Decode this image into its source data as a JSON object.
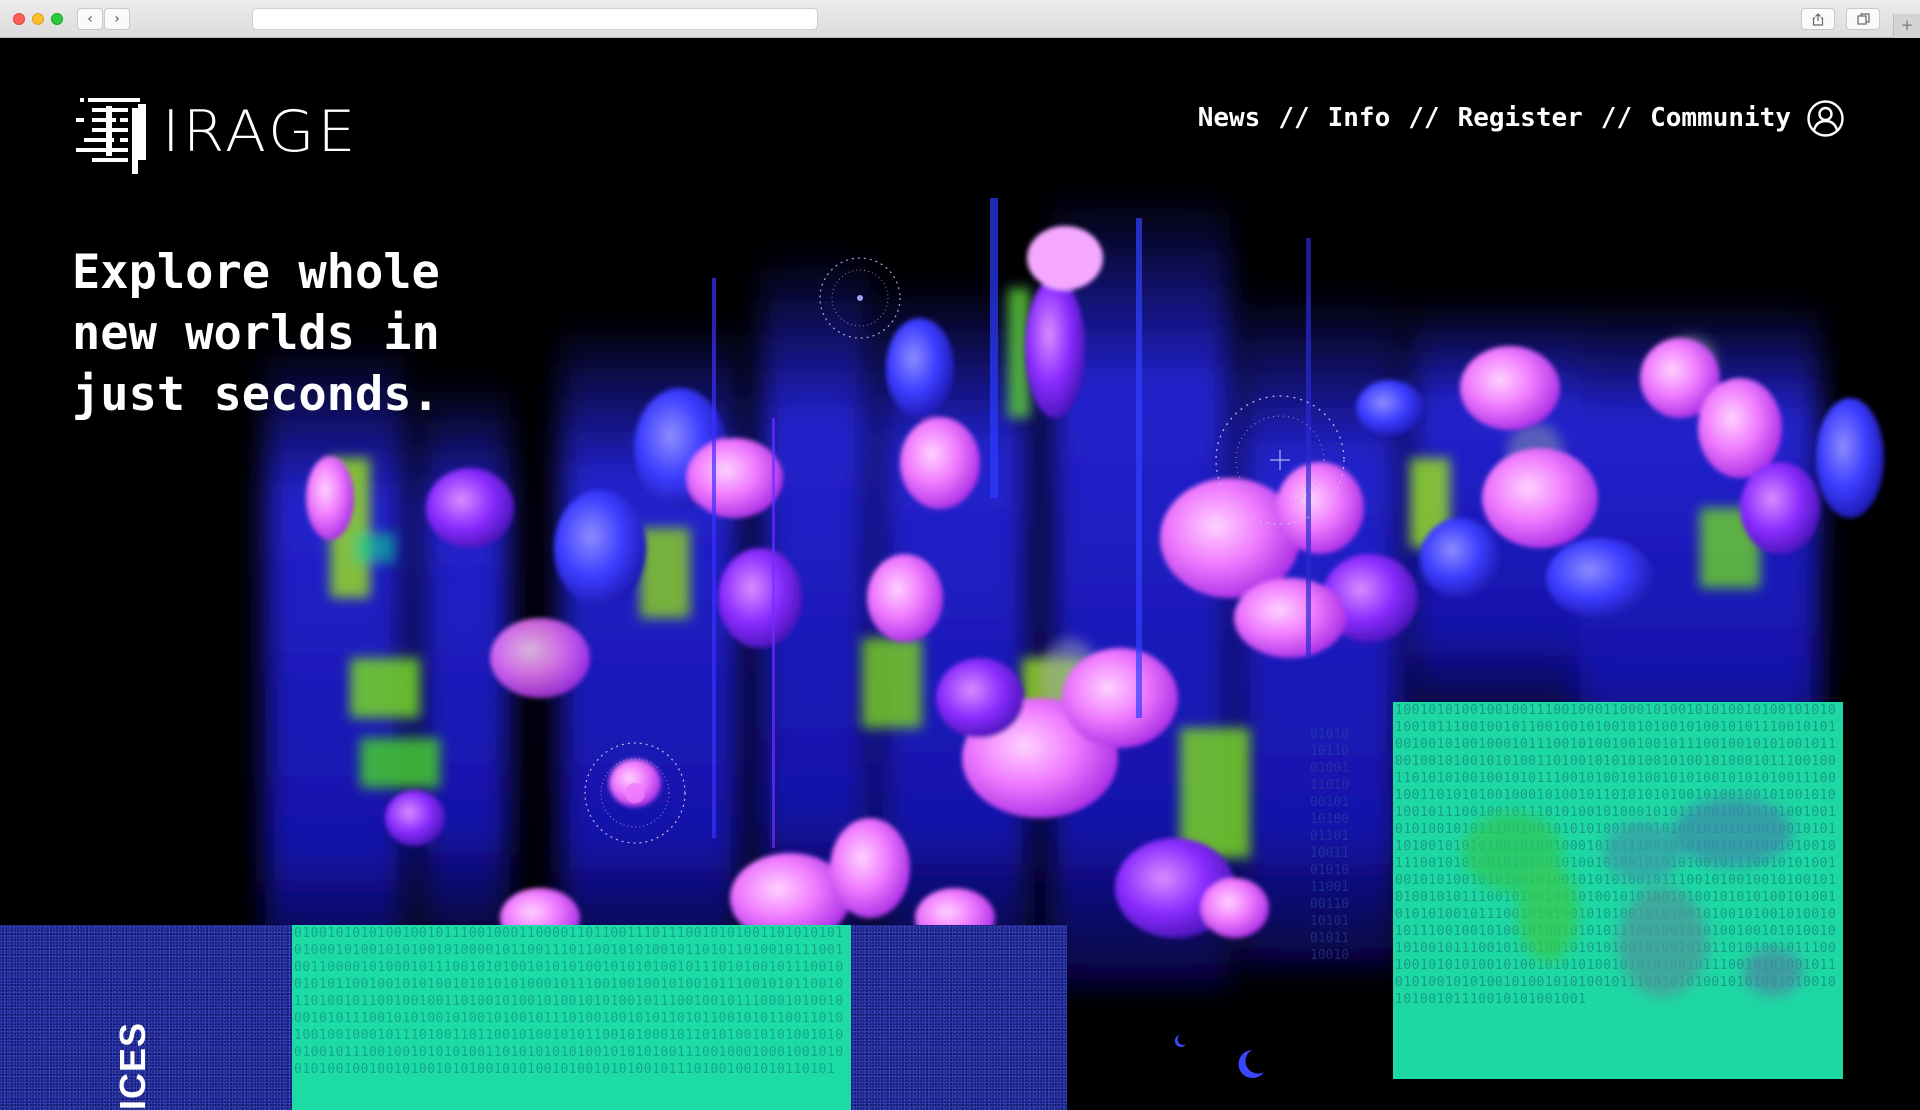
{
  "brand": {
    "logo_text": "IRAGE"
  },
  "nav": {
    "items": [
      {
        "label": "News"
      },
      {
        "label": "Info"
      },
      {
        "label": "Register"
      },
      {
        "label": "Community"
      }
    ],
    "separator": "//"
  },
  "hero": {
    "headline": "Explore whole new worlds in just seconds."
  },
  "section": {
    "side_label": "ICES"
  },
  "binary": {
    "left": "01001010101001001011100100011000011011001110111001010100110101010101000101001010100101000010110011101100101010010110101101001011100100110000101000101110010101001010101001010101001011101010010111001001010110010010101001010101010001011100100100101001011100101011001011010010110010010011010010100101001010100101110010010111000101001000101011100101010010100101001011101001001010110101100101011001101010010010001011101001101100101001010110010100010110101001010100101001001011100100101010100110101010101001010101001110010001000100101001010010010010100101010010101001010010101001011101001001010110101",
    "right": "100101010010010011100100011000101001010100101001010101001011100100101100100101001010100101001010111001010100100101001000101110010100100100101110010010101001011001001010010101001101001010101001010010100010111001001101010100100101011100101001010010101001010101001110010011010101001000101001011010101010010100100101001010100101110010010111010100101000101011100100101010010010101001010111001001010101001000101001010101001001010110100101010100101001000101011100101010010101001010010111001010100101010010100101001010101001011100101010010010101001010100101001010101001011100101001001010010101001010111001010010010100101010010100101010100101001010101001011100101010010101001010100101001010010100101011100100101001010010101011100100101010010010101001010100101110010100100101010100101001010110101001011100100101010100101001010101001010101001011100101010010110101001010100101001010100101110010101001010100101001010100101110010101001001"
  },
  "colors": {
    "accent_teal": "#1ed9a3",
    "noise_blue": "#1b1d84",
    "flower_magenta": "#e25cff",
    "flower_blue": "#3b3cff"
  },
  "icons": {
    "user": "user-circle-icon",
    "share": "share-icon",
    "tabs": "tabs-icon",
    "back": "chevron-left-icon",
    "forward": "chevron-right-icon"
  }
}
